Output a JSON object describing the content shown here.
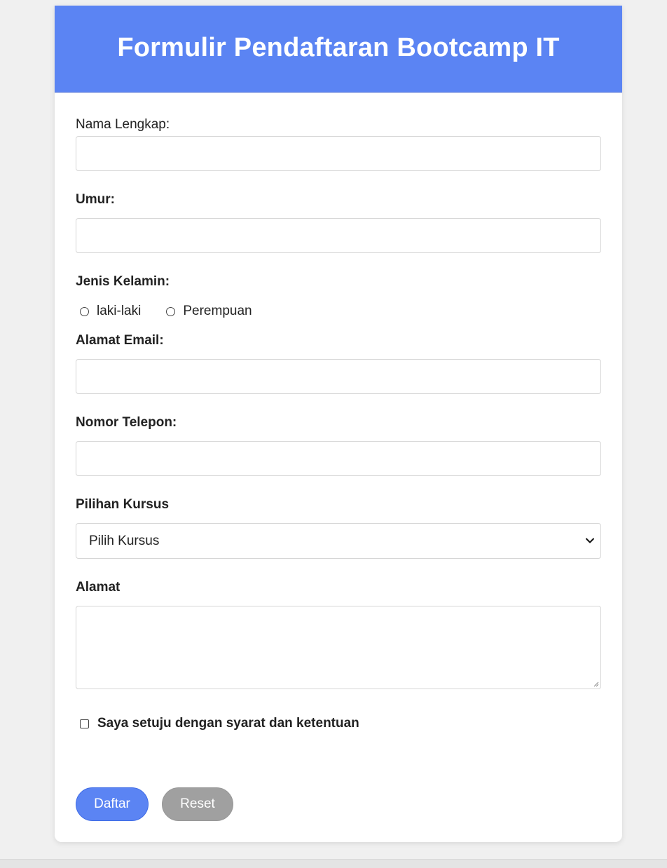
{
  "header": {
    "title": "Formulir Pendaftaran Bootcamp IT"
  },
  "form": {
    "nama": {
      "label": "Nama Lengkap:",
      "value": ""
    },
    "umur": {
      "label": "Umur:",
      "value": ""
    },
    "jenis_kelamin": {
      "label": "Jenis Kelamin:",
      "options": [
        "laki-laki",
        "Perempuan"
      ]
    },
    "email": {
      "label": "Alamat Email:",
      "value": ""
    },
    "telepon": {
      "label": "Nomor Telepon:",
      "value": ""
    },
    "kursus": {
      "label": "Pilihan Kursus",
      "selected": "Pilih Kursus"
    },
    "alamat": {
      "label": "Alamat",
      "value": ""
    },
    "agree_label": "Saya setuju dengan syarat dan ketentuan",
    "submit_label": "Daftar",
    "reset_label": "Reset"
  },
  "colors": {
    "accent": "#5b84f3",
    "secondary_button": "#a0a0a0",
    "page_background": "#f0f0f0"
  },
  "icons": {
    "select_arrow": "chevron-down-icon",
    "textarea_resize": "resize-handle-icon"
  }
}
